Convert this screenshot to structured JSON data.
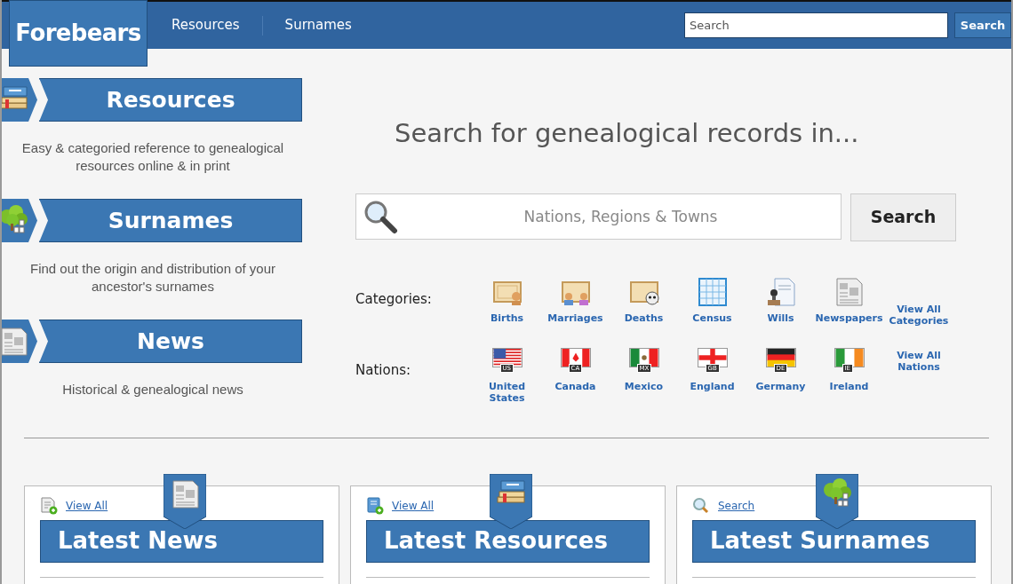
{
  "header": {
    "logo": "Forebears",
    "nav": [
      {
        "label": "Resources"
      },
      {
        "label": "Surnames"
      }
    ],
    "search": {
      "placeholder": "Search",
      "button": "Search"
    }
  },
  "sections": [
    {
      "title": "Resources",
      "description": "Easy & categoried reference to genealogical resources online & in print"
    },
    {
      "title": "Surnames",
      "description": "Find out the origin and distribution of your ancestor's surnames"
    },
    {
      "title": "News",
      "description": "Historical & genealogical news"
    }
  ],
  "main": {
    "heading": "Search for genealogical records in...",
    "search": {
      "placeholder": "Nations, Regions & Towns",
      "button": "Search"
    },
    "categories": {
      "label": "Categories:",
      "items": [
        {
          "label": "Births"
        },
        {
          "label": "Marriages"
        },
        {
          "label": "Deaths"
        },
        {
          "label": "Census"
        },
        {
          "label": "Wills"
        },
        {
          "label": "Newspapers"
        }
      ],
      "view_all": "View All Categories"
    },
    "nations": {
      "label": "Nations:",
      "items": [
        {
          "label": "United States",
          "code": "US"
        },
        {
          "label": "Canada",
          "code": "CA"
        },
        {
          "label": "Mexico",
          "code": "MX"
        },
        {
          "label": "England",
          "code": "GB"
        },
        {
          "label": "Germany",
          "code": "DE"
        },
        {
          "label": "Ireland",
          "code": "IE"
        }
      ],
      "view_all": "View All Nations"
    }
  },
  "cards": [
    {
      "link": "View All",
      "title": "Latest News"
    },
    {
      "link": "View All",
      "title": "Latest Resources"
    },
    {
      "link": "Search",
      "title": "Latest Surnames"
    }
  ]
}
